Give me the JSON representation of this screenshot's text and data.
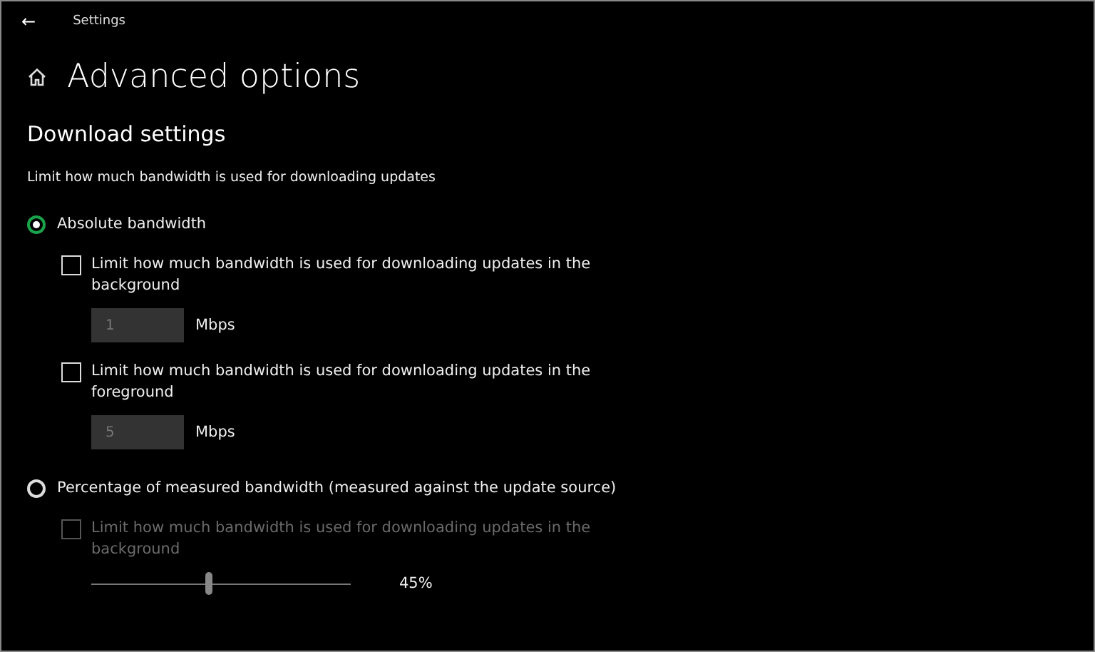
{
  "window": {
    "title": "Settings",
    "back": "←"
  },
  "page_title": "Advanced options",
  "section": {
    "heading": "Download settings",
    "description": "Limit how much bandwidth is used for downloading updates"
  },
  "options": [
    {
      "label": "Absolute bandwidth",
      "selected": true,
      "limits": [
        {
          "kind": "field",
          "label": "Limit how much bandwidth is used for downloading updates in the background",
          "checked": false,
          "disabled": false,
          "value": "1",
          "unit": "Mbps"
        },
        {
          "kind": "field",
          "label": "Limit how much bandwidth is used for downloading updates in the foreground",
          "checked": false,
          "disabled": false,
          "value": "5",
          "unit": "Mbps"
        }
      ]
    },
    {
      "label": "Percentage of measured bandwidth (measured against the update source)",
      "selected": false,
      "limits": [
        {
          "kind": "slider",
          "label": "Limit how much bandwidth is used for downloading updates in the background",
          "checked": false,
          "disabled": true,
          "level": 0.45,
          "reading": "45%"
        }
      ]
    }
  ]
}
